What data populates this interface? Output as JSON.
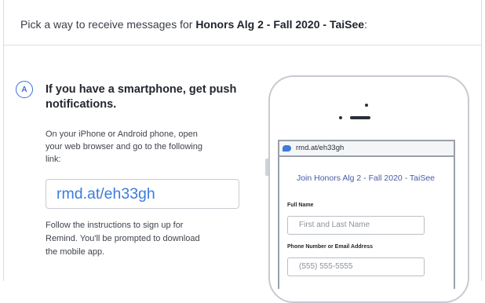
{
  "header": {
    "prefix": "Pick a way to receive messages for ",
    "class_name": "Honors Alg 2 - Fall 2020 - TaiSee",
    "suffix": ":"
  },
  "option_a": {
    "badge": "A",
    "title": "If you have a smartphone, get push notifications.",
    "instructions": "On your iPhone or Android phone, open your web browser and go to the following link:",
    "link": "rmd.at/eh33gh",
    "follow_up": "Follow the instructions to sign up for Remind. You'll be prompted to download the mobile app."
  },
  "phone_preview": {
    "url": "rmd.at/eh33gh",
    "join_title": "Join Honors Alg 2 - Fall 2020 - TaiSee",
    "full_name_label": "Full Name",
    "full_name_placeholder": "First and Last Name",
    "contact_label": "Phone Number or Email Address",
    "contact_placeholder": "(555) 555-5555"
  },
  "colors": {
    "accent": "#3d7bdc",
    "title_blue": "#4a5aa8"
  }
}
